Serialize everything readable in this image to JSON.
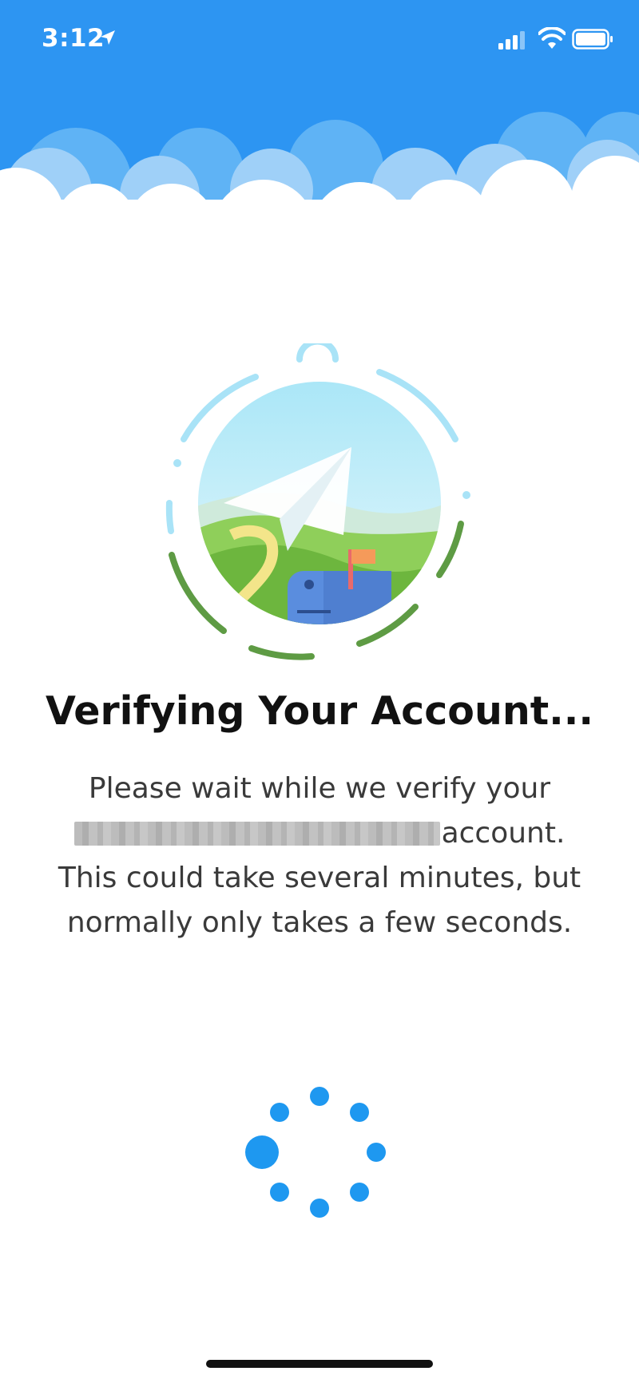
{
  "status_bar": {
    "time": "3:12",
    "icons": [
      "location-arrow-icon",
      "cellular-signal-icon",
      "wifi-icon",
      "battery-icon"
    ]
  },
  "hero": {
    "illustration": "paper-plane-over-hills-with-mailbox",
    "icon_names": [
      "paper-plane-icon",
      "mailbox-icon"
    ]
  },
  "title": "Verifying Your Account...",
  "message": {
    "line1": "Please wait while we verify your",
    "line2_suffix": "account.",
    "line3": "This could take several minutes, but",
    "line4": "normally only takes a few seconds."
  },
  "spinner": {
    "label": "loading-spinner"
  },
  "colors": {
    "header_blue": "#2d95f2",
    "spinner_blue": "#1e98f0",
    "ring_light_blue": "#a9e3f7",
    "ring_green": "#5e9b44",
    "title_text": "#111111",
    "body_text": "#3a3a3a"
  }
}
